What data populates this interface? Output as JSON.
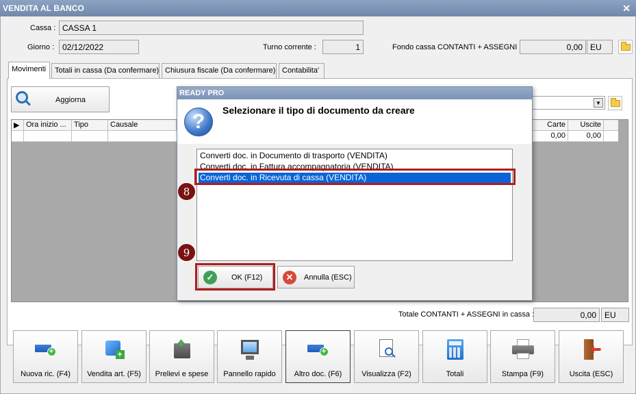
{
  "window": {
    "title": "VENDITA AL BANCO",
    "close_glyph": "✕"
  },
  "header": {
    "cassa_label": "Cassa :",
    "cassa_value": "CASSA 1",
    "giorno_label": "Giorno :",
    "giorno_value": "02/12/2022",
    "turno_label": "Turno corrente :",
    "turno_value": "1",
    "fondo_label": "Fondo cassa CONTANTI + ASSEGNI :",
    "fondo_value": "0,00",
    "fondo_currency": "EU"
  },
  "tabs": [
    {
      "label": "Movimenti",
      "active": true
    },
    {
      "label": "Totali in cassa (Da confermare)"
    },
    {
      "label": "Chiusura fiscale (Da confermare)"
    },
    {
      "label": "Contabilita'"
    }
  ],
  "toolbar": {
    "aggiorna_label": "Aggiorna"
  },
  "grid": {
    "columns": [
      "Ora inizio ...",
      "Tipo",
      "Causale",
      "Carte",
      "Uscite"
    ],
    "row": {
      "carte": "0,00",
      "uscite": "0,00"
    }
  },
  "footer": {
    "totale_label": "Totale CONTANTI + ASSEGNI in cassa :",
    "totale_value": "0,00",
    "totale_currency": "EU"
  },
  "buttons": [
    {
      "label": "Nuova ric. (F4)",
      "icon": "add-document-icon"
    },
    {
      "label": "Vendita art. (F5)",
      "icon": "box-add-icon"
    },
    {
      "label": "Prelievi e spese",
      "icon": "safe-icon"
    },
    {
      "label": "Pannello rapido",
      "icon": "monitor-icon"
    },
    {
      "label": "Altro doc. (F6)",
      "icon": "add-document-icon"
    },
    {
      "label": "Visualizza (F2)",
      "icon": "document-search-icon"
    },
    {
      "label": "Totali",
      "icon": "calculator-icon"
    },
    {
      "label": "Stampa (F9)",
      "icon": "printer-icon"
    },
    {
      "label": "Uscita (ESC)",
      "icon": "exit-icon"
    }
  ],
  "dialog": {
    "title": "READY PRO",
    "heading": "Selezionare il tipo di documento da creare",
    "icon": "question-icon",
    "options": [
      "Converti doc. in Documento di trasporto (VENDITA)",
      "Converti doc. in Fattura accompagnatoria (VENDITA)",
      "Converti doc. in Ricevuta di cassa (VENDITA)"
    ],
    "selected_index": 2,
    "ok_label": "OK (F12)",
    "cancel_label": "Annulla (ESC)"
  },
  "annotations": {
    "marker_8": "8",
    "marker_9": "9"
  },
  "colors": {
    "title_bar": "#7f95b4",
    "selection": "#0a64d8",
    "highlight_box": "#b01c1c",
    "marker": "#7a1212"
  }
}
